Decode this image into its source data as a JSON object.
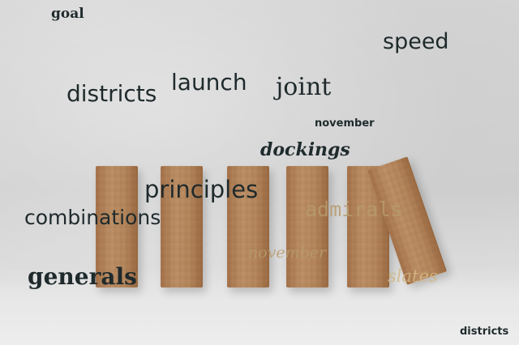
{
  "words": {
    "goal": "goal",
    "speed": "speed",
    "districts": "districts",
    "launch": "launch",
    "joint": "joint",
    "november_top": "november",
    "dockings": "dockings",
    "principles": "principles",
    "combinations": "combinations",
    "admirals": "admirals",
    "november_mid": "november",
    "generals": "generals",
    "slates": "slates",
    "districts_corner": "districts"
  },
  "colors": {
    "dark_text": "#1f2a2c",
    "tan_text": "#b79b6e",
    "wood": "#b7895f"
  }
}
